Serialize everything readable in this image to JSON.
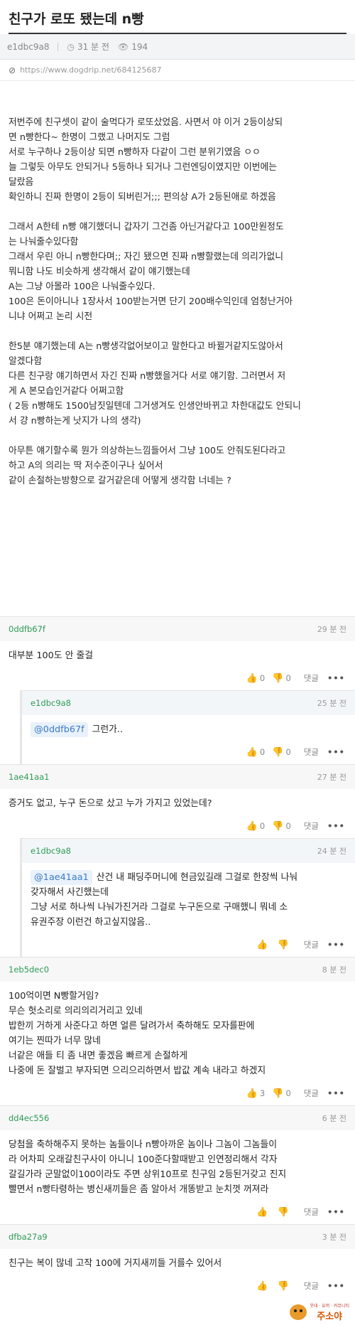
{
  "post": {
    "title": "친구가 로또 됐는데 n빵",
    "author": "e1dbc9a8",
    "time": "31 분 전",
    "views": "194",
    "url": "https://www.dogdrip.net/684125687",
    "paragraphs": [
      [
        "저번주에 친구셋이 같이 술먹다가 로또샀었음. 사면서 야 이거 2등이상되",
        "면 n빵한다~ 한명이 그랬고 나머지도 그럼",
        "서로 누구하나 2등이상 되면 n빵하자 다같이 그런 분위기였음 ㅇㅇ",
        "늘 그렇듯 아무도 안되거나 5등하나 되거나 그런엔딩이였지만 이번에는",
        "달랐음",
        "확인하니 진짜 한명이 2등이 되버린거;;;  편의상 A가 2등된애로 하겠음"
      ],
      [
        "그래서 A한테 n빵 얘기했더니 갑자기 그건좀 아닌거같다고 100만원정도",
        "는 나눠줄수있다함",
        "그래서 우린 아니 n빵한다며;; 자긴 됐으면 진짜 n빵할랬는데 의리가없니",
        "뭐니함 나도 비슷하게 생각해서 같이 얘기했는데",
        "A는 그냥 아몰라 100은 나눠줄수있다.",
        "100은 돈이아니나 1장사서 100받는거면 단기 200배수익인데 엄청난거아",
        "니냐 어쩌고 논리 시전"
      ],
      [
        "한5분 얘기했는데 A는 n빵생각없어보이고 말한다고 바뀔거같지도않아서",
        "알겠다함",
        "다른 친구랑 얘기하면서 자긴 진짜 n빵했을거다 서로 얘기함. 그러면서 저",
        "게 A 본모습인거같다 어쩌고함",
        "( 2등 n빵해도 1500남짓일텐데 그거생겨도 인생안바뀌고 차한대값도 안되니",
        "서 걍 n빵하는게 낫지가 나의 생각)"
      ],
      [
        "아무튼 얘기할수록 뭔가 의상하는느낌들어서 그냥 100도 안줘도된다라고",
        "하고 A의 의리는 딱 저수준이구나 싶어서",
        "같이 손절하는방향으로 갈거같은데 어떻게 생각함 너네는 ?"
      ]
    ]
  },
  "labels": {
    "reply": "댓글",
    "more": "•••"
  },
  "comments": [
    {
      "author": "0ddfb67f",
      "time": "29 분 전",
      "lines": [
        "대부분 100도 안 줄걸"
      ],
      "votes": "0",
      "downvotes": "0",
      "is_reply": false,
      "mention": ""
    },
    {
      "author": "e1dbc9a8",
      "time": "25 분 전",
      "lines": [
        "그런가.."
      ],
      "votes": "0",
      "downvotes": "0",
      "is_reply": true,
      "mention": "@0ddfb67f"
    },
    {
      "author": "1ae41aa1",
      "time": "27 분 전",
      "lines": [
        "증거도 없고, 누구 돈으로 샀고 누가 가지고 있었는데?"
      ],
      "votes": "0",
      "downvotes": "0",
      "is_reply": false,
      "mention": ""
    },
    {
      "author": "e1dbc9a8",
      "time": "24 분 전",
      "lines": [
        "산건 내 패딩주머니에 현금있길래 그걸로 한장씩 나눠",
        "갖자해서 사긴했는데",
        "그냥 서로 하나씩 나눠가진거라 그걸로 누구돈으로 구매했니 뭐네 소",
        "유권주장 이런건 하고싶지않음.."
      ],
      "votes": "",
      "downvotes": "",
      "is_reply": true,
      "mention": "@1ae41aa1"
    },
    {
      "author": "1eb5dec0",
      "time": "8 분 전",
      "lines": [
        "100억이면 N빵할거임?",
        "무슨 헛소리로 의리의리거리고 있네",
        "밥한끼 거하게 사준다고 하면 얼른 달려가서 축하해도 모자를판에",
        "여기는 찐따가 너무 많네",
        "너같은 애들 티 좀 내면 좋겠음 빠르게 손절하게",
        "나중에 돈 잘벌고 부자되면 으리으리하면서 밥값 계속 내라고 하겠지"
      ],
      "votes": "3",
      "downvotes": "0",
      "is_reply": false,
      "mention": ""
    },
    {
      "author": "dd4ec556",
      "time": "6 분 전",
      "lines": [
        "당첨을 축하해주지 못하는 놈들이나 n빵아까운 놈이나 그놈이 그놈들이",
        "라 어차피 오래갈친구사이 아니니 100준다할때받고 인연정리해서 각자",
        "갈길가라 군말없이100이라도 주면 상위10프로 친구임 2등된거갖고 진지",
        "빨면서 n빵타령하는 병신새끼들은 좀 알아서 개똥받고 눈치껏 꺼져라"
      ],
      "votes": "",
      "downvotes": "",
      "is_reply": false,
      "mention": ""
    },
    {
      "author": "dfba27a9",
      "time": "3 분 전",
      "lines": [
        "친구는 복이 많네 고작 100에 거지새끼들 거를수 있어서"
      ],
      "votes": "",
      "downvotes": "",
      "is_reply": false,
      "mention": ""
    }
  ],
  "watermark": {
    "small": "웃대 · 유머 · 커뮤니티",
    "big": "주소야"
  },
  "colors": {
    "author": "#2e9b55",
    "mention": "#3a7bc8",
    "meta_bg": "#f3f4f6"
  }
}
